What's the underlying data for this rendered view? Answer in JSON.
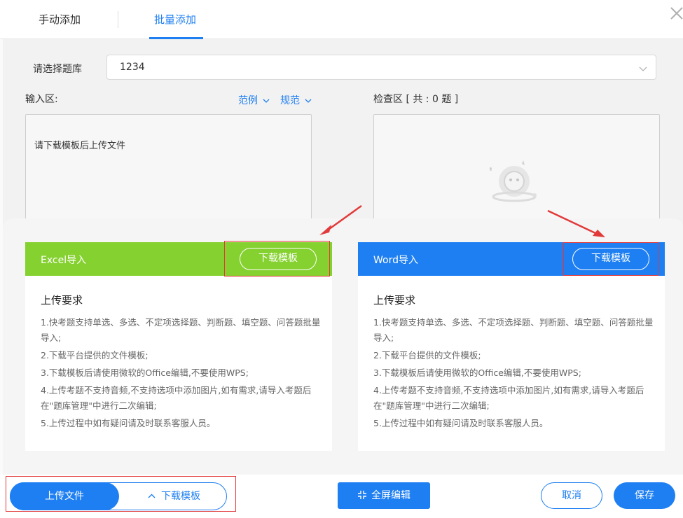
{
  "tabs": {
    "manual": "手动添加",
    "batch": "批量添加"
  },
  "library": {
    "label": "请选择题库",
    "value": "1234"
  },
  "input": {
    "label": "输入区:",
    "example_link": "范例",
    "rules_link": "规范",
    "placeholder": "请下载模板后上传文件"
  },
  "check": {
    "label": "检查区 [ 共 : 0 题 ]"
  },
  "excel_card": {
    "title": "Excel导入",
    "download_label": "下载模板",
    "requirements_title": "上传要求",
    "requirements": [
      "1.快考题支持单选、多选、不定项选择题、判断题、填空题、问答题批量导入;",
      "2.下载平台提供的文件模板;",
      "3.下载模板后请使用微软的Office编辑,不要使用WPS;",
      "4.上传考题不支持音频,不支持选项中添加图片,如有需求,请导入考题后 在\"题库管理\"中进行二次编辑;",
      "5.上传过程中如有疑问请及时联系客服人员。"
    ]
  },
  "word_card": {
    "title": "Word导入",
    "download_label": "下载模板",
    "requirements_title": "上传要求",
    "requirements": [
      "1.快考题支持单选、多选、不定项选择题、判断题、填空题、问答题批量导入;",
      "2.下载平台提供的文件模板;",
      "3.下载模板后请使用微软的Office编辑,不要使用WPS;",
      "4.上传考题不支持音频,不支持选项中添加图片,如有需求,请导入考题后 在\"题库管理\"中进行二次编辑;",
      "5.上传过程中如有疑问请及时联系客服人员。"
    ]
  },
  "footer": {
    "upload_label": "上传文件",
    "download_template_label": "下载模板",
    "fullscreen_label": "全屏编辑",
    "cancel_label": "取消",
    "save_label": "保存"
  },
  "colors": {
    "accent": "#1e7ff2",
    "excel_green": "#85d130",
    "annotation_red": "#e23a3a"
  }
}
